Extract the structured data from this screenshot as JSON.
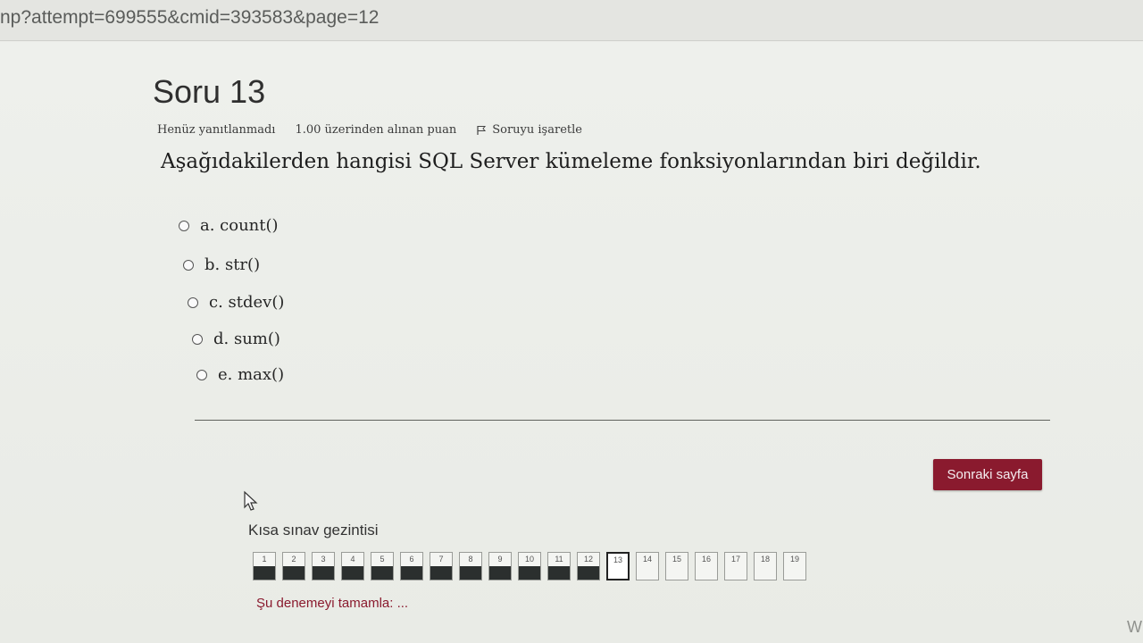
{
  "browser": {
    "url": "np?attempt=699555&cmid=393583&page=12"
  },
  "question": {
    "title": "Soru 13",
    "status": "Henüz yanıtlanmadı",
    "points": "1.00 üzerinden alınan puan",
    "flag_label": "Soruyu işaretle",
    "text": "Aşağıdakilerden hangisi SQL Server kümeleme fonksiyonlarından biri değildir."
  },
  "options": [
    {
      "label": "a. count()"
    },
    {
      "label": "b. str()"
    },
    {
      "label": "c. stdev()"
    },
    {
      "label": "d. sum()"
    },
    {
      "label": "e. max()"
    }
  ],
  "next_button": "Sonraki sayfa",
  "navigation": {
    "title": "Kısa sınav gezintisi",
    "buttons": [
      {
        "label": "1",
        "answered": true
      },
      {
        "label": "2",
        "answered": true
      },
      {
        "label": "3",
        "answered": true
      },
      {
        "label": "4",
        "answered": true
      },
      {
        "label": "5",
        "answered": true
      },
      {
        "label": "6",
        "answered": true
      },
      {
        "label": "7",
        "answered": true
      },
      {
        "label": "8",
        "answered": true
      },
      {
        "label": "9",
        "answered": true
      },
      {
        "label": "10",
        "answered": true
      },
      {
        "label": "11",
        "answered": true
      },
      {
        "label": "12",
        "answered": true
      },
      {
        "label": "13",
        "answered": false,
        "current": true
      },
      {
        "label": "14",
        "answered": false
      },
      {
        "label": "15",
        "answered": false
      },
      {
        "label": "16",
        "answered": false
      },
      {
        "label": "17",
        "answered": false
      },
      {
        "label": "18",
        "answered": false
      },
      {
        "label": "19",
        "answered": false
      }
    ],
    "finish_link": "Şu denemeyi tamamla: ..."
  },
  "corner_text": "W",
  "colors": {
    "accent": "#8a1a2e",
    "answered_fill": "#2b2f2e"
  }
}
